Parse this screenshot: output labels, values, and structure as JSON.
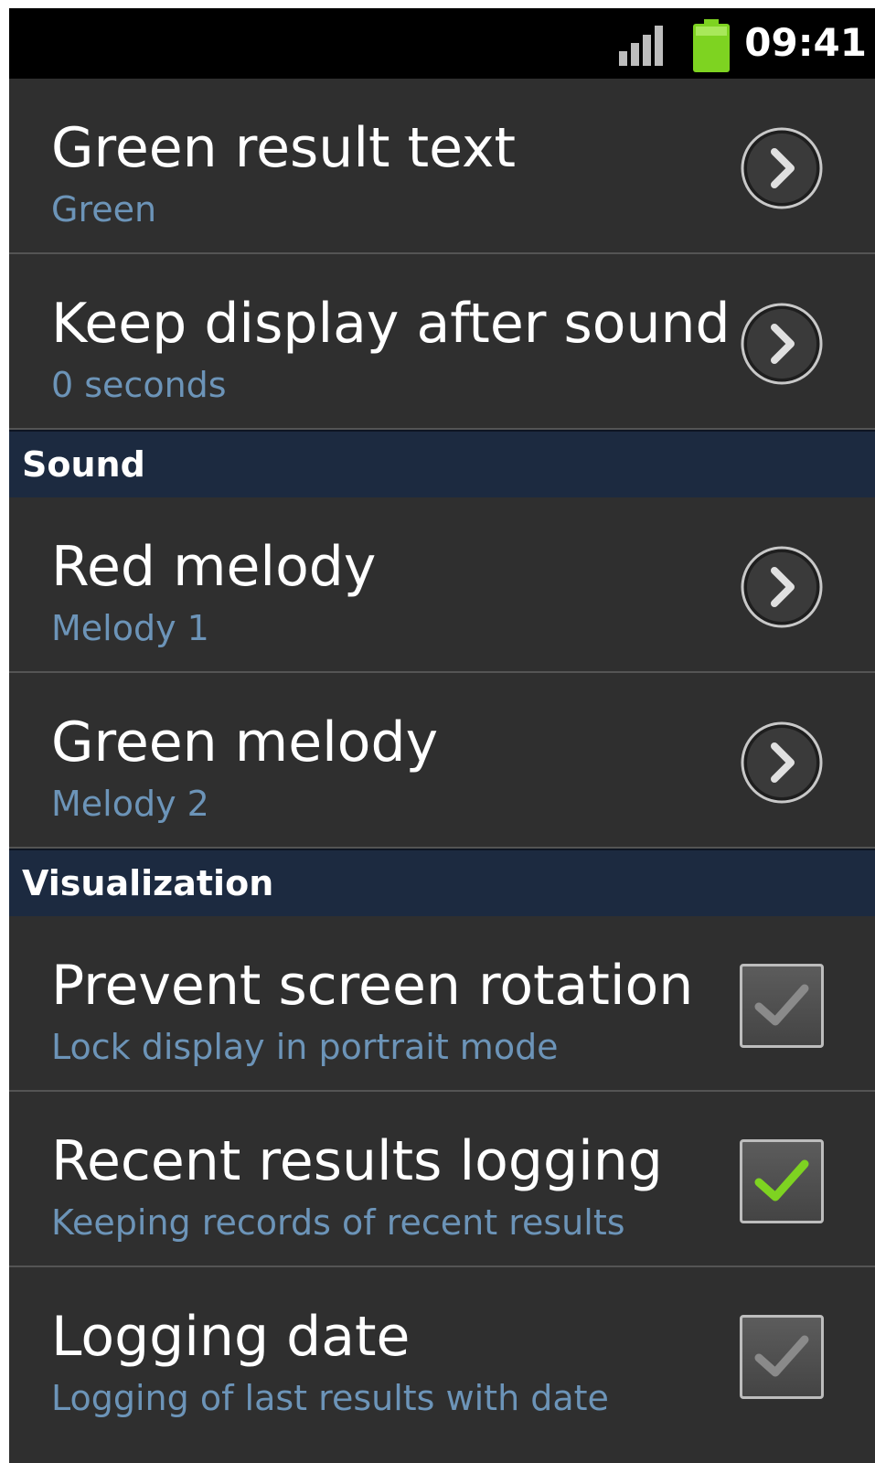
{
  "status_bar": {
    "time": "09:41",
    "signal_icon": "signal-bars-icon",
    "battery_icon": "battery-icon",
    "battery_color": "#7ed321"
  },
  "colors": {
    "background": "#2f2f2f",
    "summary_text": "#6c94b8",
    "section_header": "#1c2a40",
    "check_active": "#7ed321",
    "check_inactive": "#8a8a8a"
  },
  "display_items": [
    {
      "title": "Green result text",
      "summary": "Green",
      "control": "arrow"
    },
    {
      "title": "Keep display after sound",
      "summary": "0 seconds",
      "control": "arrow"
    }
  ],
  "sound_section": {
    "header": "Sound",
    "items": [
      {
        "title": "Red melody",
        "summary": "Melody 1",
        "control": "arrow"
      },
      {
        "title": "Green melody",
        "summary": "Melody 2",
        "control": "arrow"
      }
    ]
  },
  "visualization_section": {
    "header": "Visualization",
    "items": [
      {
        "title": "Prevent screen rotation",
        "summary": "Lock display in portrait mode",
        "control": "checkbox",
        "checked": false
      },
      {
        "title": "Recent results logging",
        "summary": "Keeping records of recent results",
        "control": "checkbox",
        "checked": true
      },
      {
        "title": "Logging date",
        "summary": "Logging of last results with date",
        "control": "checkbox",
        "checked": false
      }
    ]
  }
}
